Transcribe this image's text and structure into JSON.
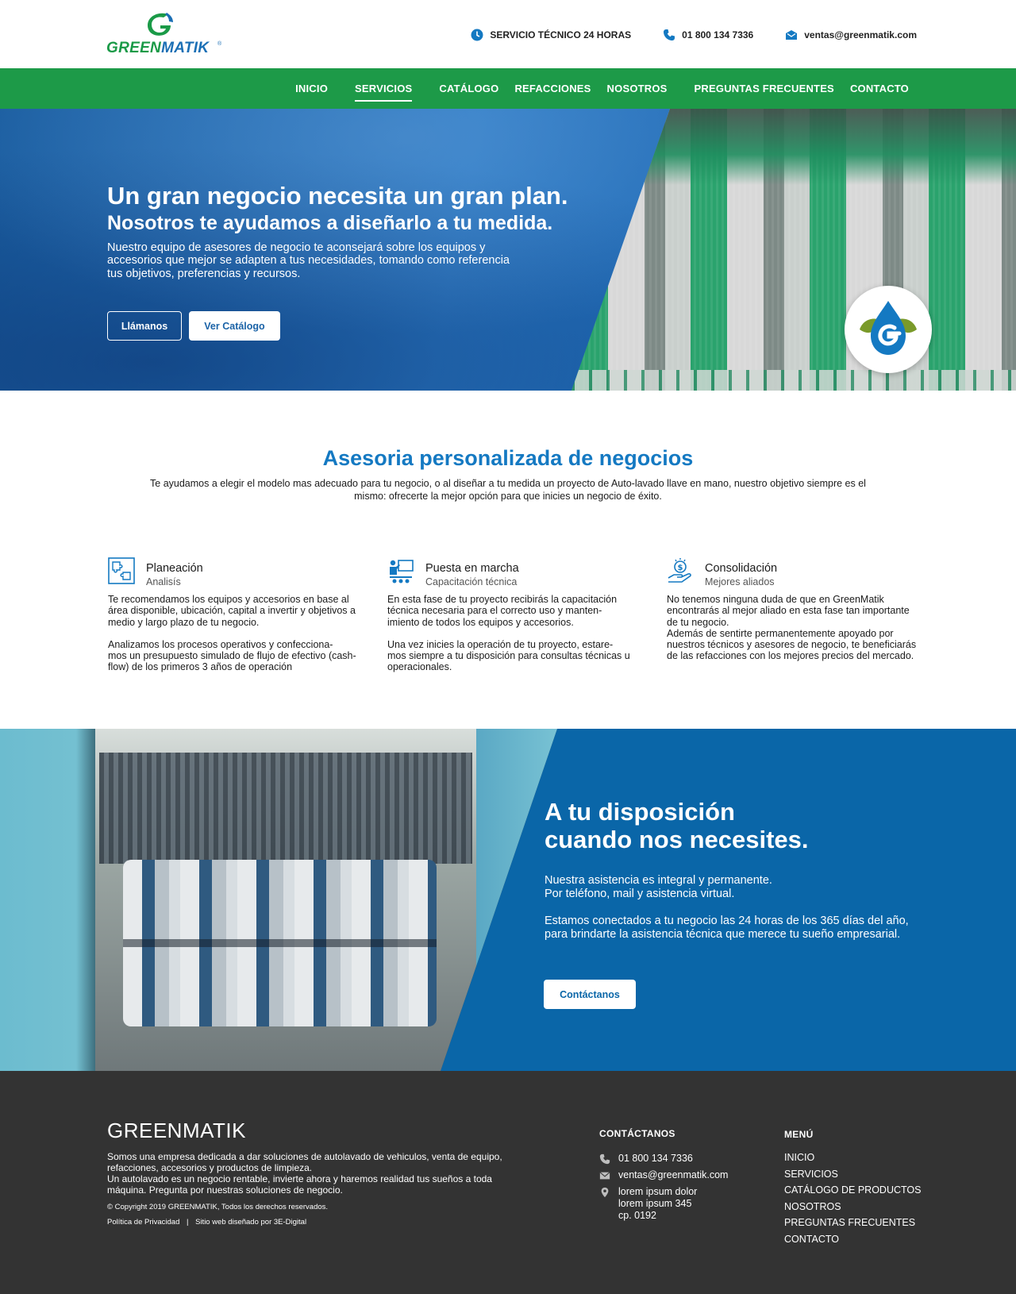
{
  "brand": {
    "name_part1": "GREEN",
    "name_part2": "MATIK",
    "reg": "®"
  },
  "topbar": {
    "service": "SERVICIO TÉCNICO 24 HORAS",
    "phone": "01 800 134 7336",
    "email": "ventas@greenmatik.com"
  },
  "nav": {
    "items": [
      "INICIO",
      "SERVICIOS",
      "CATÁLOGO",
      "REFACCIONES",
      "NOSOTROS",
      "PREGUNTAS FRECUENTES",
      "CONTACTO"
    ],
    "active": "SERVICIOS"
  },
  "hero": {
    "title": "Un gran negocio necesita un gran plan.",
    "subtitle": "Nosotros te ayudamos a diseñarlo a tu medida.",
    "text": "Nuestro equipo de asesores de negocio te aconsejará sobre los equipos y accesorios que mejor se adapten a tus necesidades, tomando como referencia tus objetivos, preferencias y recursos.",
    "btn_call": "Llámanos",
    "btn_catalog": "Ver Catálogo"
  },
  "asesoria": {
    "title": "Asesoria personalizada de negocios",
    "lead": "Te ayudamos a elegir el modelo mas adecuado para tu negocio, o al diseñar a tu medida un proyecto de Auto-lavado llave en mano, nuestro objetivo siempre es el mismo: ofrecerte la mejor opción para que inicies un negocio de éxito.",
    "columns": [
      {
        "title": "Planeación",
        "subtitle": "Analisís",
        "icon": "puzzle-icon",
        "p1": "Te recomendamos los equipos y accesorios en base al área disponible, ubicación, capital a invertir y objetivos a medio y largo plazo de tu negocio.",
        "p2": "Analizamos los procesos operativos y confecciona-\nmos un presupuesto simulado de flujo de efectivo (cash-flow) de los primeros 3 años de operación"
      },
      {
        "title": "Puesta en marcha",
        "subtitle": "Capacitación técnica",
        "icon": "training-icon",
        "p1": "En esta fase de tu proyecto recibirás la capacitación técnica necesaria para el correcto uso y manten-\nimiento de todos los equipos y accesorios.",
        "p2": "Una vez inicies la operación de tu proyecto, estare-\nmos siempre a tu disposición para consultas técnicas u operacionales."
      },
      {
        "title": "Consolidación",
        "subtitle": "Mejores aliados",
        "icon": "money-hand-icon",
        "p1": "No tenemos ninguna duda de que en GreenMatik encontrarás al mejor aliado en esta fase tan importante de tu negocio.\nAdemás de sentirte permanentemente apoyado por nuestros técnicos y asesores de negocio, te beneficiarás de las refacciones con los mejores precios del mercado.",
        "p2": ""
      }
    ]
  },
  "dispo": {
    "title_line1": "A tu disposición",
    "title_line2": "cuando nos necesites.",
    "p1": "Nuestra asistencia es integral y permanente.\nPor teléfono, mail y asistencia virtual.",
    "p2": "Estamos conectados a tu negocio las 24 horas de los 365 días del año, para brindarte la asistencia técnica que merece tu sueño empresarial.",
    "button": "Contáctanos"
  },
  "footer": {
    "brand": "GREENMATIK",
    "about": "Somos una empresa dedicada a dar soluciones de autolavado de vehiculos, venta de equipo, refacciones, accesorios y productos de limpieza.\nUn autolavado es un negocio rentable, invierte ahora y haremos realidad tus sueños a toda máquina. Pregunta por nuestras soluciones de negocio.",
    "copyright": "© Copyright 2019 GREENMATIK, Todos los derechos reservados.",
    "privacy": "Política de Privacidad",
    "separator": "|",
    "credits": "Sitio web diseñado por 3E-Digital",
    "contact_heading": "CONTÁCTANOS",
    "phone": "01 800 134 7336",
    "email": "ventas@greenmatik.com",
    "address": "lorem ipsum dolor\nlorem ipsum 345\ncp. 0192",
    "menu_heading": "MENÚ",
    "menu": [
      "INICIO",
      "SERVICIOS",
      "CATÁLOGO DE PRODUCTOS",
      "NOSOTROS",
      "PREGUNTAS FRECUENTES",
      "CONTACTO"
    ]
  },
  "colors": {
    "nav_green": "#1d9a48",
    "brand_blue": "#1479c2",
    "section_blue": "#0a66a8",
    "footer_dark": "#333333"
  }
}
